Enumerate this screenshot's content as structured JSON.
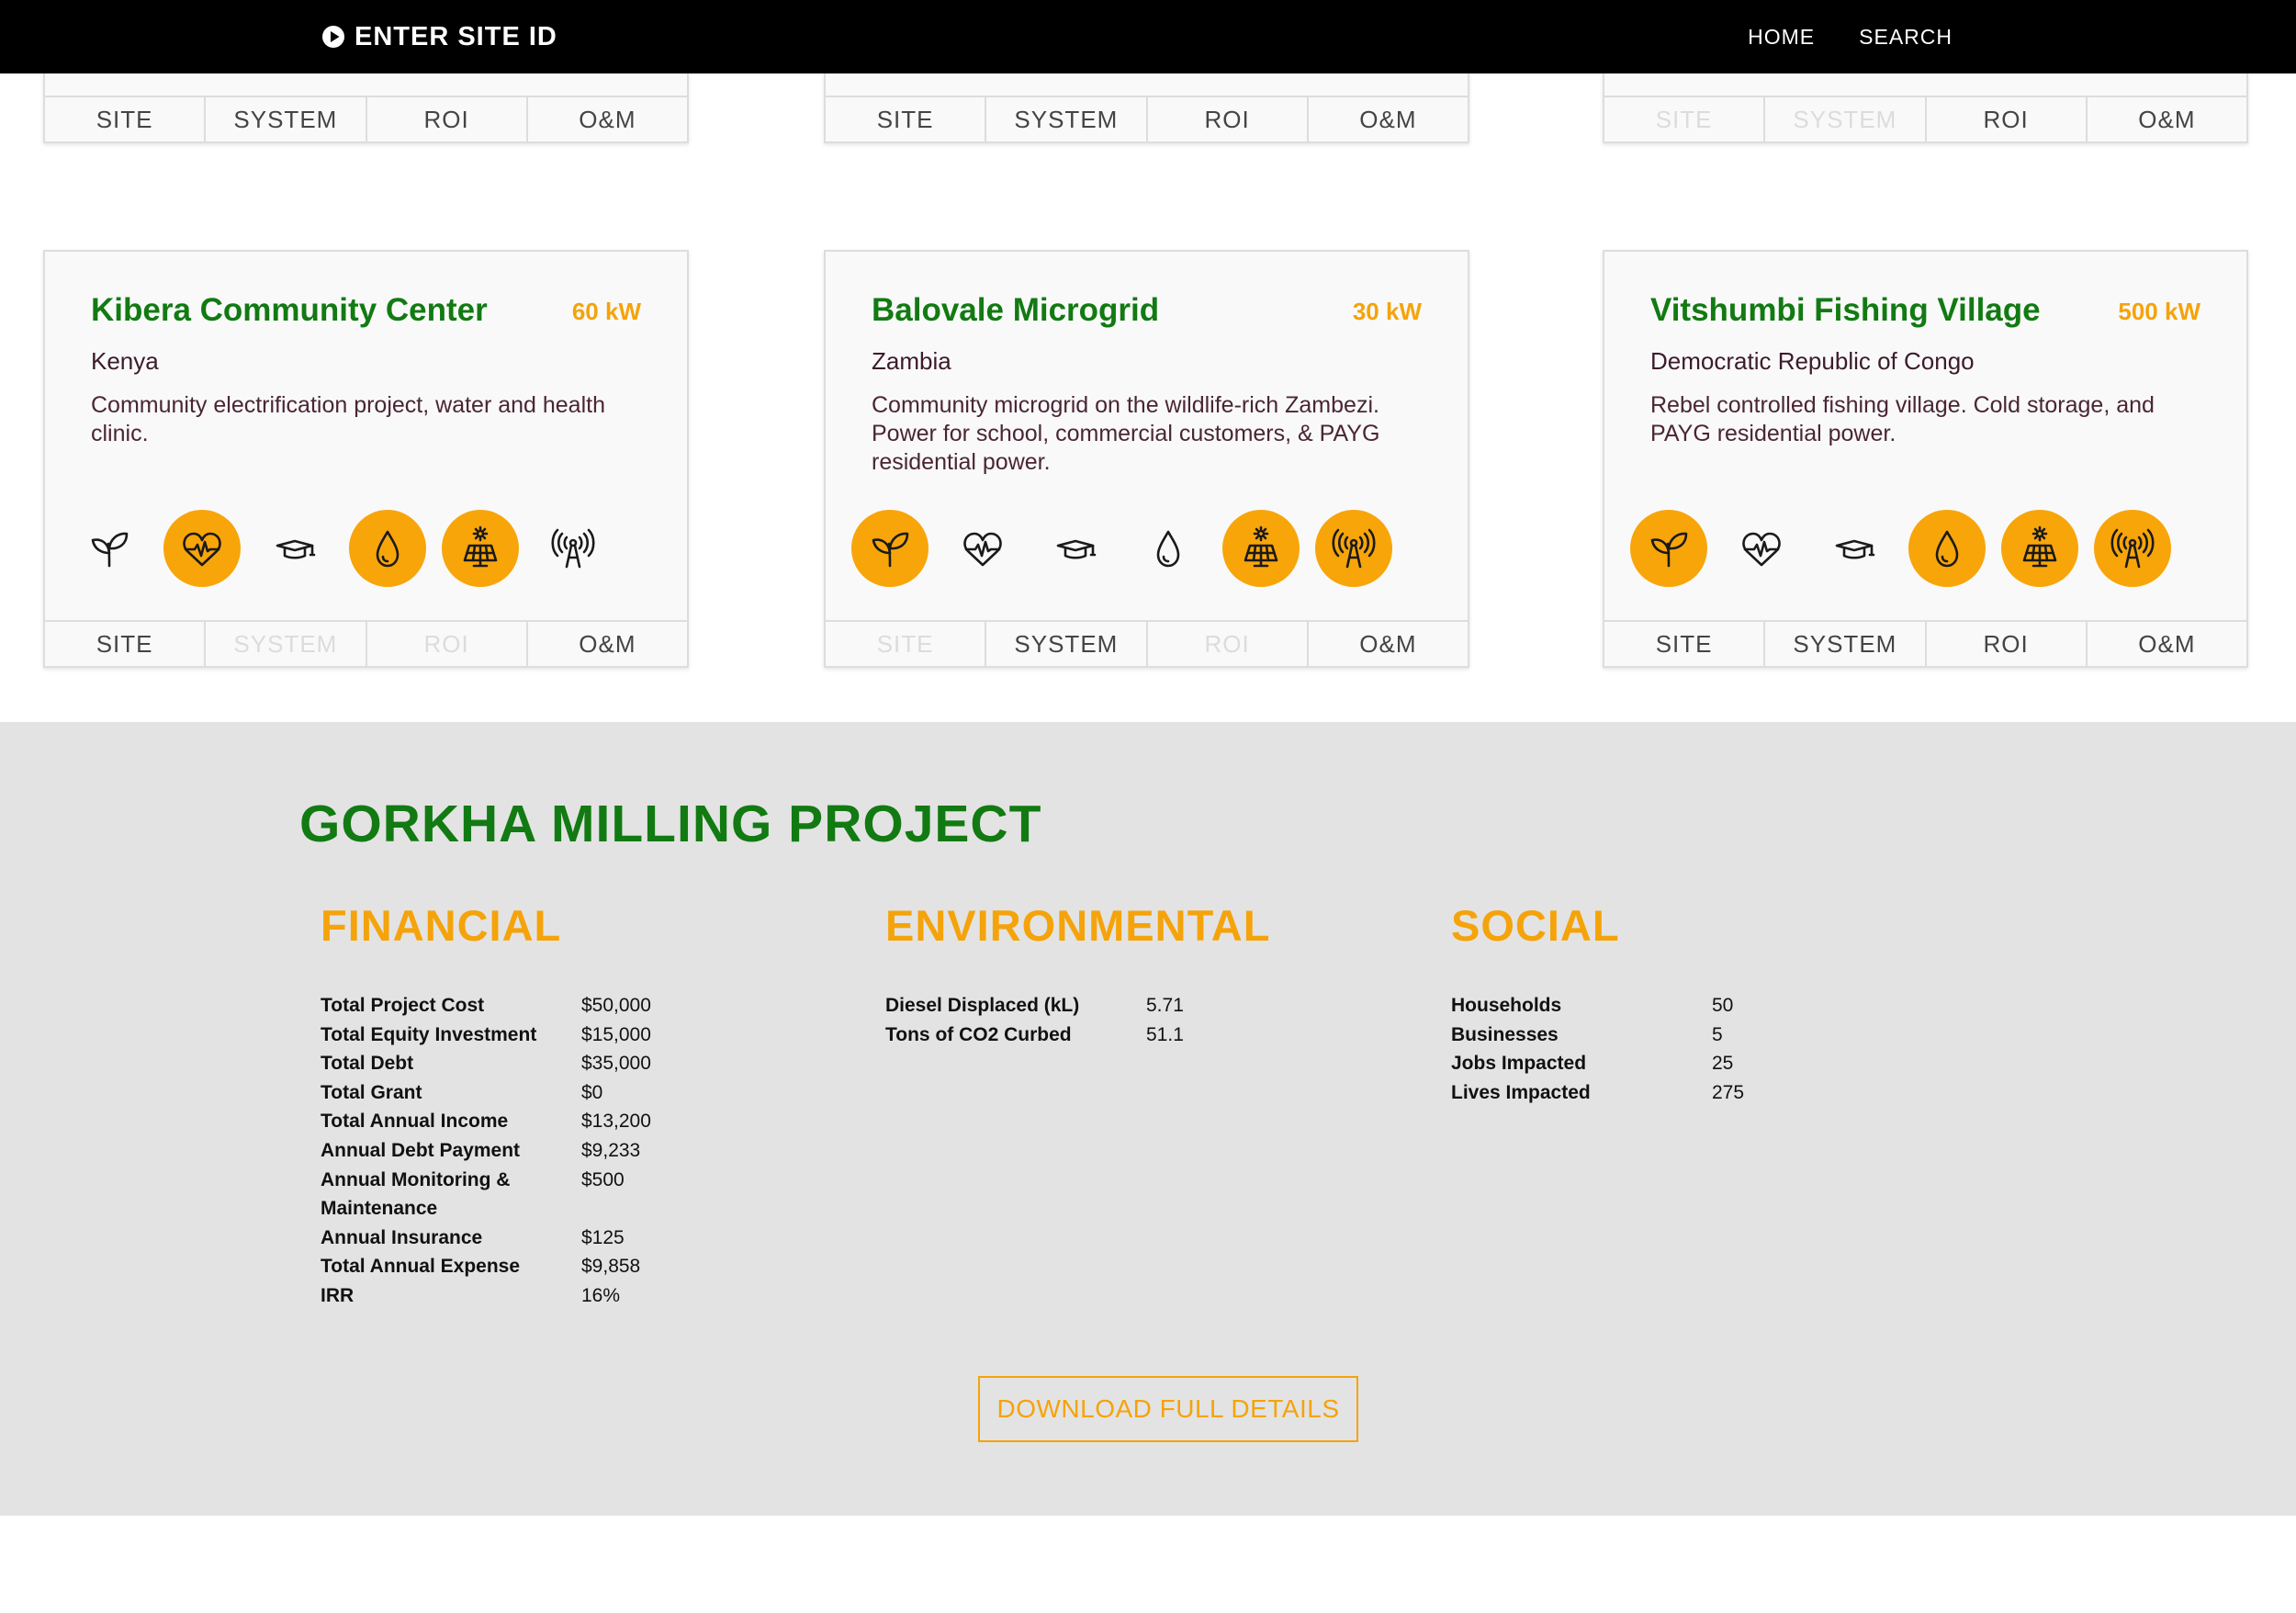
{
  "nav": {
    "brand": "ENTER SITE ID",
    "links": [
      "HOME",
      "SEARCH"
    ]
  },
  "top_cards": [
    {
      "tabs": [
        {
          "label": "SITE",
          "enabled": true
        },
        {
          "label": "SYSTEM",
          "enabled": true
        },
        {
          "label": "ROI",
          "enabled": true
        },
        {
          "label": "O&M",
          "enabled": true
        }
      ]
    },
    {
      "tabs": [
        {
          "label": "SITE",
          "enabled": true
        },
        {
          "label": "SYSTEM",
          "enabled": true
        },
        {
          "label": "ROI",
          "enabled": true
        },
        {
          "label": "O&M",
          "enabled": true
        }
      ]
    },
    {
      "tabs": [
        {
          "label": "SITE",
          "enabled": false
        },
        {
          "label": "SYSTEM",
          "enabled": false
        },
        {
          "label": "ROI",
          "enabled": true
        },
        {
          "label": "O&M",
          "enabled": true
        }
      ]
    }
  ],
  "cards": [
    {
      "title": "Kibera Community Center",
      "power": "60 kW",
      "country": "Kenya",
      "description": "Community electrification project, water and health clinic.",
      "icons": [
        {
          "name": "leaf-icon",
          "active": false
        },
        {
          "name": "heart-health-icon",
          "active": true
        },
        {
          "name": "graduation-cap-icon",
          "active": false
        },
        {
          "name": "water-drop-icon",
          "active": true
        },
        {
          "name": "solar-panel-icon",
          "active": true
        },
        {
          "name": "antenna-icon",
          "active": false
        }
      ],
      "tabs": [
        {
          "label": "SITE",
          "enabled": true
        },
        {
          "label": "SYSTEM",
          "enabled": false
        },
        {
          "label": "ROI",
          "enabled": false
        },
        {
          "label": "O&M",
          "enabled": true
        }
      ]
    },
    {
      "title": "Balovale Microgrid",
      "power": "30 kW",
      "country": "Zambia",
      "description": "Community microgrid on the wildlife-rich Zambezi. Power for school, commercial customers, & PAYG residential power.",
      "icons": [
        {
          "name": "leaf-icon",
          "active": true
        },
        {
          "name": "heart-health-icon",
          "active": false
        },
        {
          "name": "graduation-cap-icon",
          "active": false
        },
        {
          "name": "water-drop-icon",
          "active": false
        },
        {
          "name": "solar-panel-icon",
          "active": true
        },
        {
          "name": "antenna-icon",
          "active": true
        }
      ],
      "tabs": [
        {
          "label": "SITE",
          "enabled": false
        },
        {
          "label": "SYSTEM",
          "enabled": true
        },
        {
          "label": "ROI",
          "enabled": false
        },
        {
          "label": "O&M",
          "enabled": true
        }
      ]
    },
    {
      "title": "Vitshumbi Fishing Village",
      "power": "500 kW",
      "country": "Democratic Republic of Congo",
      "description": "Rebel controlled fishing village. Cold storage, and PAYG residential power.",
      "icons": [
        {
          "name": "leaf-icon",
          "active": true
        },
        {
          "name": "heart-health-icon",
          "active": false
        },
        {
          "name": "graduation-cap-icon",
          "active": false
        },
        {
          "name": "water-drop-icon",
          "active": true
        },
        {
          "name": "solar-panel-icon",
          "active": true
        },
        {
          "name": "antenna-icon",
          "active": true
        }
      ],
      "tabs": [
        {
          "label": "SITE",
          "enabled": true
        },
        {
          "label": "SYSTEM",
          "enabled": true
        },
        {
          "label": "ROI",
          "enabled": true
        },
        {
          "label": "O&M",
          "enabled": true
        }
      ]
    }
  ],
  "project": {
    "title": "GORKHA MILLING PROJECT",
    "financial": {
      "heading": "FINANCIAL",
      "rows": [
        {
          "label": "Total Project Cost",
          "value": "$50,000"
        },
        {
          "label": "Total Equity Investment",
          "value": "$15,000"
        },
        {
          "label": "Total Debt",
          "value": "$35,000"
        },
        {
          "label": "Total Grant",
          "value": "$0"
        },
        {
          "label": "Total Annual Income",
          "value": "$13,200"
        },
        {
          "label": "Annual Debt Payment",
          "value": "$9,233"
        },
        {
          "label": "Annual Monitoring & Maintenance",
          "value": "$500"
        },
        {
          "label": "Annual Insurance",
          "value": "$125"
        },
        {
          "label": "Total Annual Expense",
          "value": "$9,858"
        },
        {
          "label": "IRR",
          "value": "16%"
        }
      ]
    },
    "environmental": {
      "heading": "ENVIRONMENTAL",
      "rows": [
        {
          "label": "Diesel Displaced (kL)",
          "value": "5.71"
        },
        {
          "label": "Tons of CO2 Curbed",
          "value": "51.1"
        }
      ]
    },
    "social": {
      "heading": "SOCIAL",
      "rows": [
        {
          "label": "Households",
          "value": "50"
        },
        {
          "label": "Businesses",
          "value": "5"
        },
        {
          "label": "Jobs Impacted",
          "value": "25"
        },
        {
          "label": "Lives Impacted",
          "value": "275"
        }
      ]
    },
    "download_label": "DOWNLOAD FULL DETAILS"
  },
  "colors": {
    "title_green": "#127a12",
    "accent_orange": "#f5a30a",
    "icon_circle": "#f8a50a",
    "section_gray": "#e3e3e3",
    "nav_black": "#000000"
  }
}
